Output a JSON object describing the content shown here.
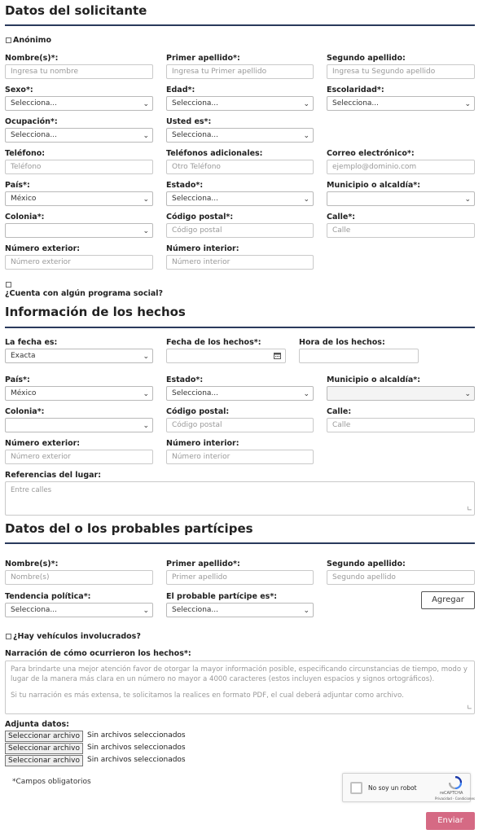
{
  "s1": {
    "title": "Datos del solicitante",
    "anon": "Anónimo",
    "nombre_l": "Nombre(s)*:",
    "nombre_p": "Ingresa tu nombre",
    "ap1_l": "Primer apellido*:",
    "ap1_p": "Ingresa tu Primer apellido",
    "ap2_l": "Segundo apellido:",
    "ap2_p": "Ingresa tu Segundo apellido",
    "sexo_l": "Sexo*:",
    "sexo_v": "Selecciona...",
    "edad_l": "Edad*:",
    "edad_v": "Selecciona...",
    "esc_l": "Escolaridad*:",
    "esc_v": "Selecciona...",
    "ocu_l": "Ocupación*:",
    "ocu_v": "Selecciona...",
    "usted_l": "Usted es*:",
    "usted_v": "Selecciona...",
    "tel_l": "Teléfono:",
    "tel_p": "Teléfono",
    "teladd_l": "Teléfonos adicionales:",
    "teladd_p": "Otro Teléfono",
    "correo_l": "Correo electrónico*:",
    "correo_p": "ejemplo@dominio.com",
    "pais_l": "País*:",
    "pais_v": "México",
    "estado_l": "Estado*:",
    "estado_v": "Selecciona...",
    "mun_l": "Municipio o alcaldía*:",
    "mun_v": "",
    "col_l": "Colonia*:",
    "col_v": "",
    "cp_l": "Código postal*:",
    "cp_p": "Código postal",
    "calle_l": "Calle*:",
    "calle_p": "Calle",
    "next_l": "Número exterior:",
    "next_p": "Número exterior",
    "nint_l": "Número interior:",
    "nint_p": "Número interior",
    "prog": "¿Cuenta con algún programa social?"
  },
  "s2": {
    "title": "Información de los hechos",
    "fecha_l": "La fecha es:",
    "fecha_v": "Exacta",
    "fh_l": "Fecha de los hechos*:",
    "hora_l": "Hora de los hechos:",
    "pais_l": "País*:",
    "pais_v": "México",
    "estado_l": "Estado*:",
    "estado_v": "Selecciona...",
    "mun_l": "Municipio o alcaldía*:",
    "mun_v": "",
    "col_l": "Colonia*:",
    "col_v": "",
    "cp_l": "Código postal:",
    "cp_p": "Código postal",
    "calle_l": "Calle:",
    "calle_p": "Calle",
    "next_l": "Número exterior:",
    "next_p": "Número exterior",
    "nint_l": "Número interior:",
    "nint_p": "Número interior",
    "ref_l": "Referencias del lugar:",
    "ref_p": "Entre calles"
  },
  "s3": {
    "title": "Datos del o los probables partícipes",
    "nombre_l": "Nombre(s)*:",
    "nombre_p": "Nombre(s)",
    "ap1_l": "Primer apellido*:",
    "ap1_p": "Primer apellido",
    "ap2_l": "Segundo apellido:",
    "ap2_p": "Segundo apellido",
    "tend_l": "Tendencia política*:",
    "tend_v": "Selecciona...",
    "part_l": "El probable partícipe es*:",
    "part_v": "Selecciona...",
    "agregar": "Agregar",
    "veh": "¿Hay vehículos involucrados?",
    "narr_l": "Narración de cómo ocurrieron los hechos*:",
    "narr_p1": "Para brindarte una mejor atención favor de otorgar la mayor información posible, especificando circunstancias de tiempo, modo y lugar de la manera más clara en un número no mayor a 4000 caracteres (estos incluyen espacios y signos ortográficos).",
    "narr_p2": "Si tu narración es más extensa, te solicitamos la realices en formato PDF, el cual deberá adjuntar como archivo.",
    "adj_l": "Adjunta datos:",
    "file_btn": "Seleccionar archivo",
    "file_txt": "Sin archivos seleccionados",
    "req": "*Campos obligatorios",
    "captcha": "No soy un robot",
    "recaptcha": "reCAPTCHA",
    "recaptcha_links": "Privacidad - Condiciones",
    "enviar": "Enviar"
  },
  "icons": {
    "chevron": "chevron-down-icon",
    "calendar": "calendar-icon",
    "recaptcha": "recaptcha-logo-icon"
  },
  "colors": {
    "rule": "#2a3a5c",
    "submit": "#d56a84"
  }
}
